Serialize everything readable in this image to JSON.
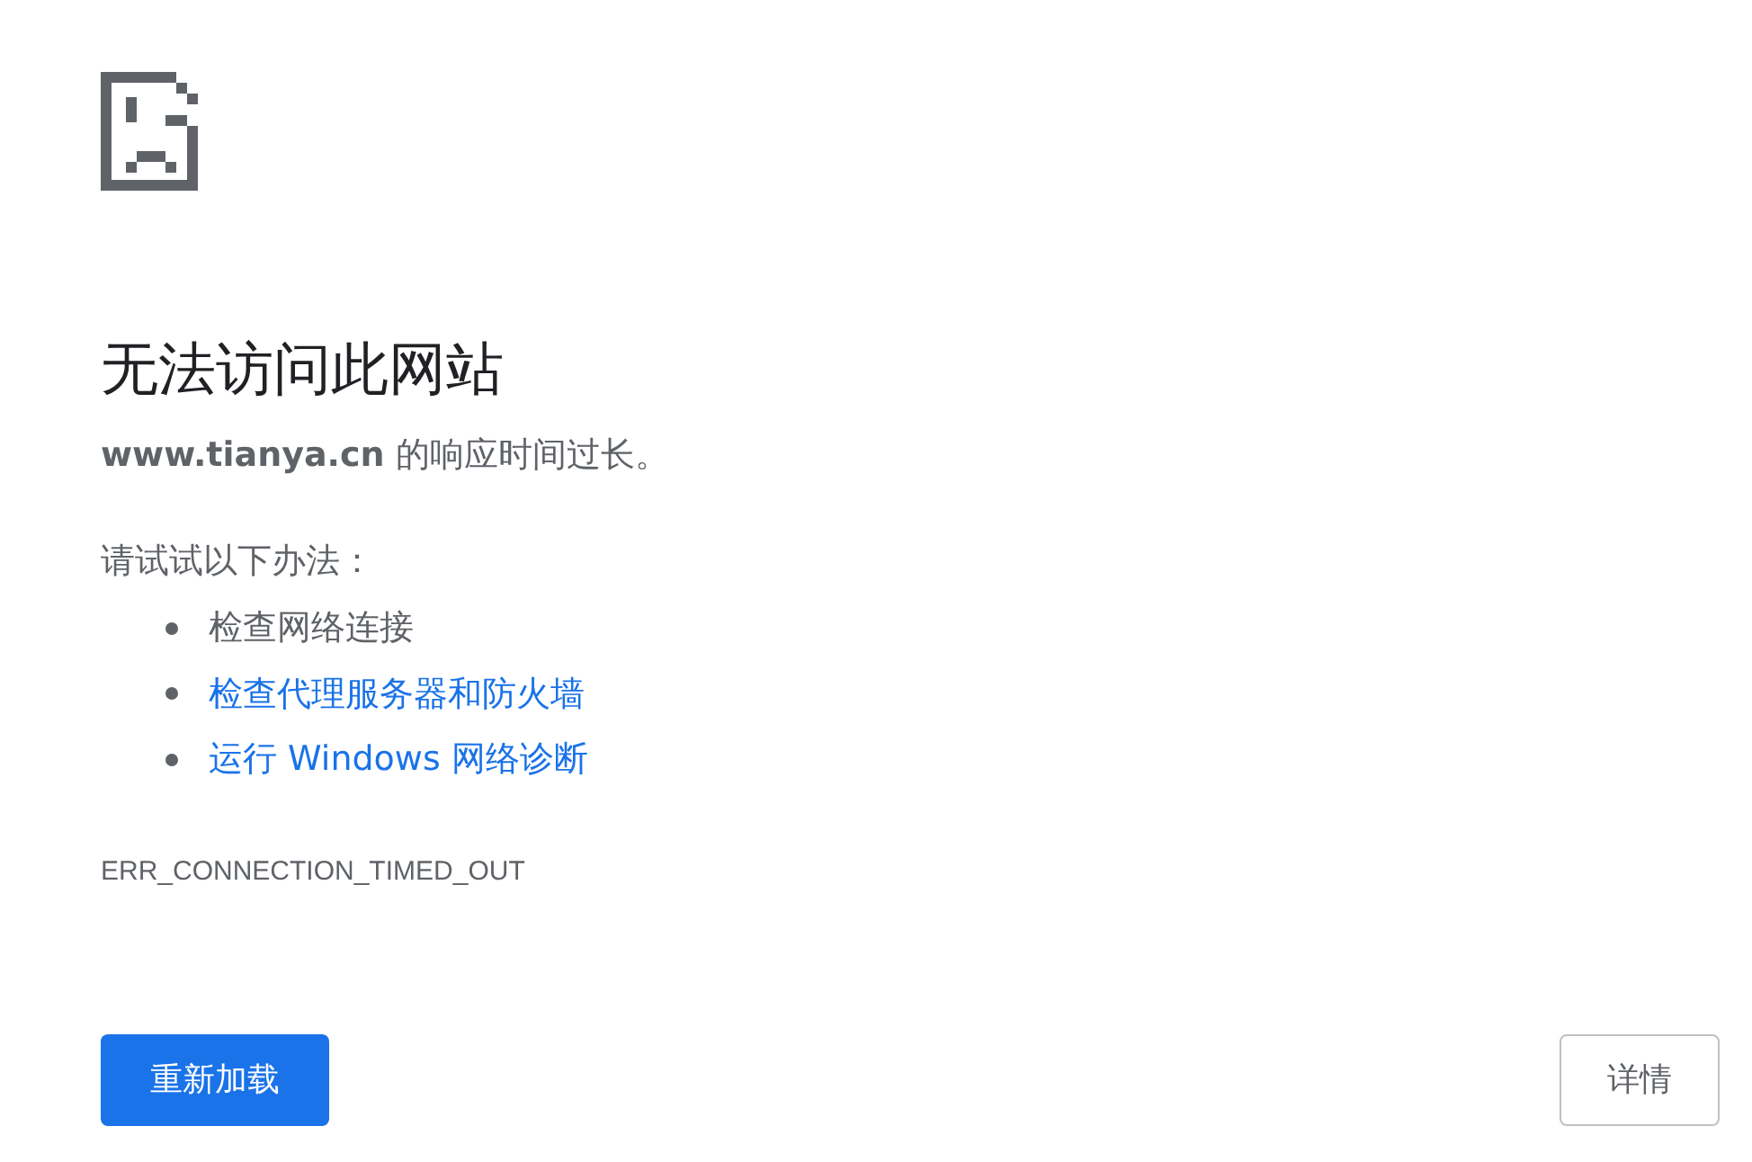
{
  "title": "无法访问此网站",
  "message": "**www.tianya.cn** 的响应时间过长。",
  "suggestions_heading": "请试试以下办法：",
  "suggestions": [
    {
      "kind": "text",
      "label": "检查网络连接"
    },
    {
      "kind": "link",
      "label": "检查代理服务器和防火墙"
    },
    {
      "kind": "link",
      "label": "运行 Windows 网络诊断"
    }
  ],
  "error_code": "ERR_CONNECTION_TIMED_OUT",
  "buttons": {
    "reload": "重新加载",
    "details": "详情"
  }
}
